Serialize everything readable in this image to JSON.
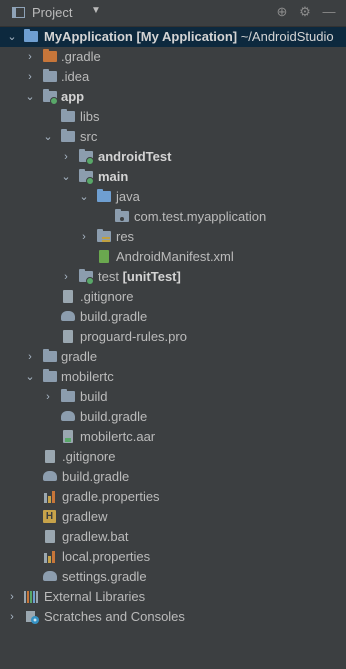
{
  "panel": {
    "title": "Project",
    "dropdown_icon": "chevron-down-icon",
    "actions": [
      "locate-icon",
      "gear-icon",
      "minimize-icon"
    ]
  },
  "tree": {
    "root_name": "MyApplication",
    "root_module": "[My Application]",
    "root_path": "~/AndroidStudio",
    "gradle_dir": ".gradle",
    "idea_dir": ".idea",
    "app": "app",
    "libs": "libs",
    "src": "src",
    "androidTest": "androidTest",
    "main": "main",
    "java": "java",
    "package": "com.test.myapplication",
    "res": "res",
    "manifest": "AndroidManifest.xml",
    "test": "test",
    "test_suffix": "[unitTest]",
    "app_gitignore": ".gitignore",
    "app_build_gradle": "build.gradle",
    "proguard": "proguard-rules.pro",
    "gradle": "gradle",
    "mobilertc": "mobilertc",
    "build": "build",
    "mobilertc_build_gradle": "build.gradle",
    "mobilertc_aar": "mobilertc.aar",
    "root_gitignore": ".gitignore",
    "root_build_gradle": "build.gradle",
    "gradle_properties": "gradle.properties",
    "gradlew": "gradlew",
    "gradlew_bat": "gradlew.bat",
    "local_properties": "local.properties",
    "settings_gradle": "settings.gradle",
    "external_libraries": "External Libraries",
    "scratches": "Scratches and Consoles"
  }
}
